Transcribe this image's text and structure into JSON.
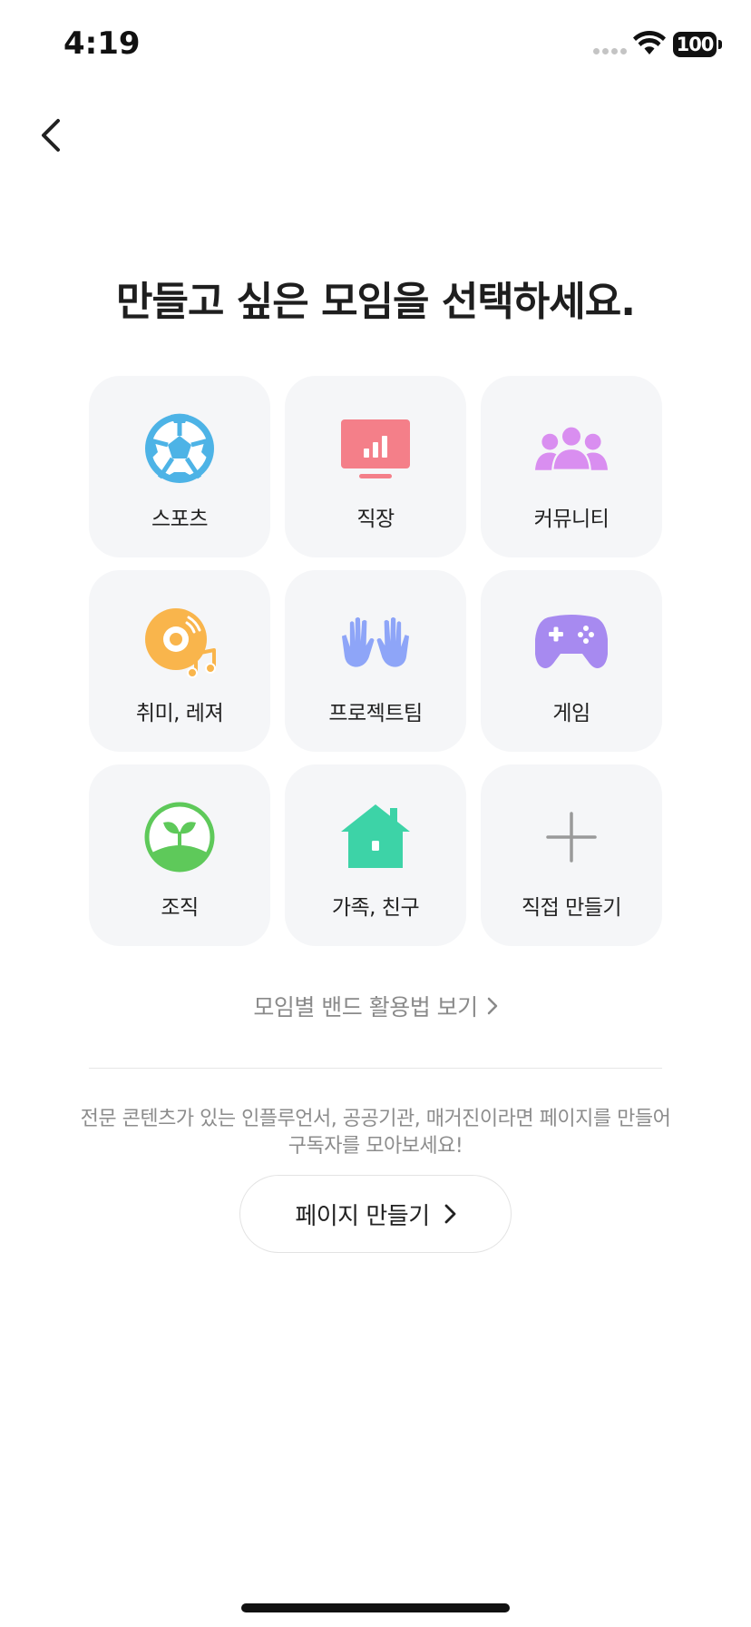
{
  "status_bar": {
    "time": "4:19",
    "battery": "100",
    "icons": [
      "signal-dots-icon",
      "wifi-icon",
      "battery-icon"
    ]
  },
  "nav": {
    "back_icon": "chevron-left-icon"
  },
  "title": "만들고 싶은 모임을 선택하세요.",
  "categories": [
    {
      "label": "스포츠",
      "icon": "soccer-ball-icon",
      "color": "#4db3e6"
    },
    {
      "label": "직장",
      "icon": "presentation-chart-icon",
      "color": "#f47f89"
    },
    {
      "label": "커뮤니티",
      "icon": "people-group-icon",
      "color": "#d98ef0"
    },
    {
      "label": "취미, 레져",
      "icon": "music-disc-icon",
      "color": "#f9b54c"
    },
    {
      "label": "프로젝트팀",
      "icon": "raised-hands-icon",
      "color": "#8ea5f8"
    },
    {
      "label": "게임",
      "icon": "gamepad-icon",
      "color": "#a78af0"
    },
    {
      "label": "조직",
      "icon": "sprout-icon",
      "color": "#5ec95a"
    },
    {
      "label": "가족, 친구",
      "icon": "house-icon",
      "color": "#3dd3a7"
    },
    {
      "label": "직접 만들기",
      "icon": "plus-icon",
      "color": "#9a9a9a"
    }
  ],
  "guide_link": {
    "label": "모임별 밴드 활용법 보기",
    "icon": "chevron-right-icon"
  },
  "page_section": {
    "description_line1": "전문 콘텐츠가 있는 인플루언서, 공공기관, 매거진이라면 페이지를 만들어",
    "description_line2": "구독자를 모아보세요!",
    "button_label": "페이지 만들기",
    "button_icon": "chevron-right-icon"
  }
}
